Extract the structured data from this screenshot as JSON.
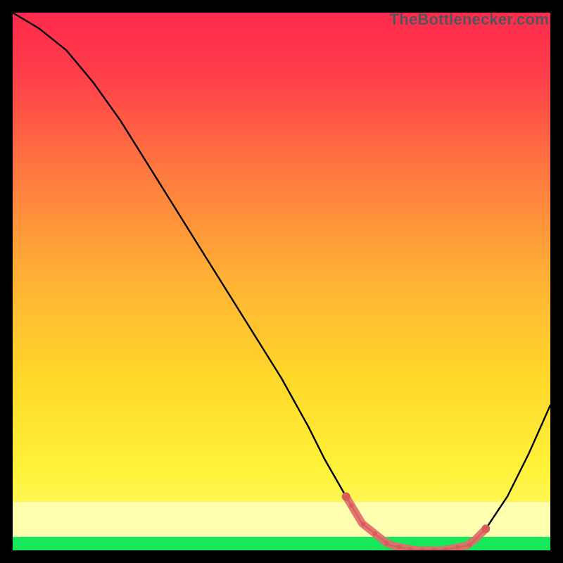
{
  "watermark": "TheBottlenecker.com",
  "chart_data": {
    "type": "line",
    "title": "",
    "xlabel": "",
    "ylabel": "",
    "xlim": [
      0,
      100
    ],
    "ylim": [
      0,
      100
    ],
    "grid": false,
    "series": [
      {
        "name": "curve",
        "x": [
          0,
          5,
          10,
          15,
          20,
          25,
          30,
          35,
          40,
          45,
          50,
          55,
          58,
          62,
          65,
          70,
          75,
          80,
          85,
          88,
          92,
          96,
          100
        ],
        "y": [
          100,
          97,
          93,
          87,
          80,
          72,
          64,
          56,
          48,
          40,
          32,
          23,
          17,
          10,
          5,
          1,
          0,
          0,
          1,
          4,
          10,
          18,
          27
        ]
      }
    ],
    "highlight_band": {
      "x0": 62,
      "x1": 88
    },
    "bottom_green_band": {
      "y0": 0,
      "y1": 2.5
    },
    "bottom_yellow_band": {
      "y0": 2.5,
      "y1": 9
    },
    "background_gradient": {
      "top_color": "#ff2a4d",
      "mid_color": "#ffd400",
      "bottom_color": "#ffff66"
    }
  }
}
